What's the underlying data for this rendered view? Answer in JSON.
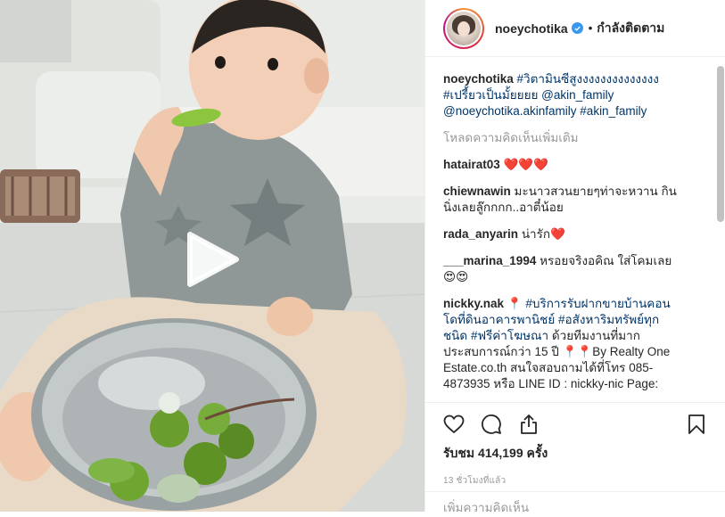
{
  "header": {
    "username": "noeychotika",
    "separator": "•",
    "follow_status": "กำลังติดตาม"
  },
  "caption": {
    "username": "noeychotika",
    "text_parts": [
      "#วิตามินซีสูงงงงงงงงงงงงงง",
      "#เปรี้ยวเป็นมั้ยยยย",
      "@akin_family",
      "@noeychotika.akinfamily",
      "#akin_family"
    ]
  },
  "load_more": "โหลดความคิดเห็นเพิ่มเติม",
  "comments": [
    {
      "username": "hatairat03",
      "text": "❤️❤️❤️"
    },
    {
      "username": "chiewnawin",
      "text": "มะนาวสวนยายๆท่าจะหวาน กินนิ่งเลยลู๊กกกก..อาตี๋น้อย"
    },
    {
      "username": "rada_anyarin",
      "text": "น่ารัก❤️"
    },
    {
      "username": "___marina_1994",
      "text": "หรอยจริงอคิณ ใส่โคมเลย😍😍"
    },
    {
      "username": "nickky.nak",
      "pin": "📍",
      "tags": [
        "#บริการรับฝากขายบ้านคอนโดที่ดินอาคารพานิชย์",
        "#อสังหาริมทรัพย์ทุกชนิด",
        "#ฟรีค่าโฆษณา"
      ],
      "text": "ด้วยทีมงานที่มากประสบการณ์กว่า 15 ปี 📍📍By Realty One Estate.co.th สนใจสอบถามได้ที่โทร 085-4873935 หรือ LINE ID : nickky-nic Page:"
    }
  ],
  "stats": {
    "views": "รับชม 414,199 ครั้ง",
    "time": "13 ชั่วโมงที่แล้ว"
  },
  "add_comment_placeholder": "เพิ่มความคิดเห็น",
  "icons": {
    "like": "heart-icon",
    "comment": "comment-icon",
    "share": "share-icon",
    "save": "bookmark-icon",
    "play": "play-icon",
    "verified": "verified-icon"
  },
  "colors": {
    "link": "#003569",
    "verified": "#3897f0",
    "muted": "#999999",
    "text": "#262626"
  }
}
